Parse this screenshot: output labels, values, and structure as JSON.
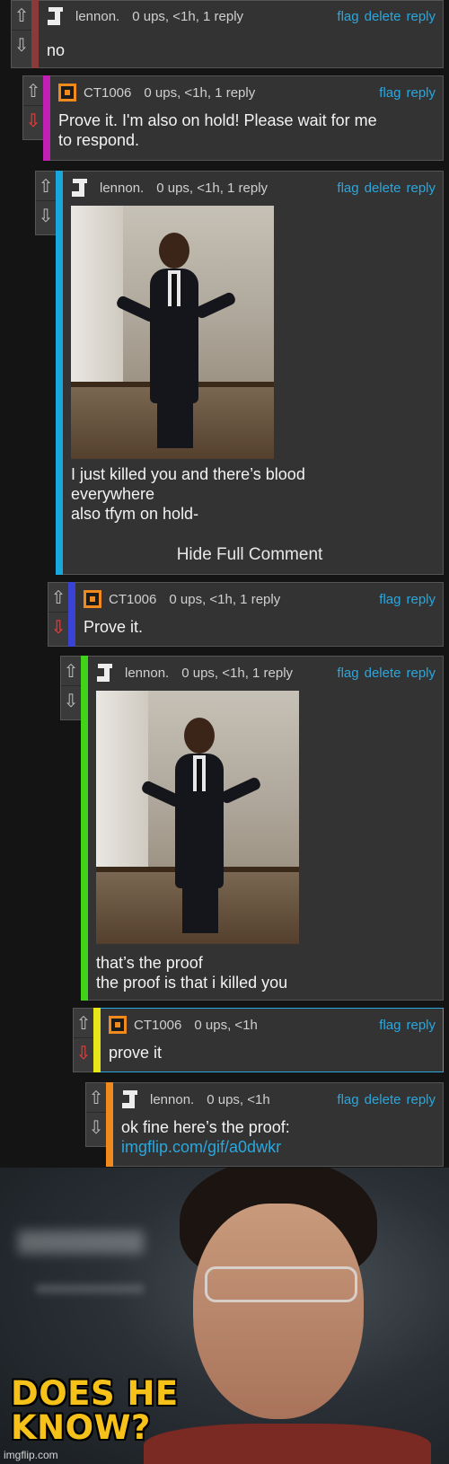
{
  "icons": {
    "upvote": "arrow-up",
    "downvote": "arrow-down"
  },
  "colors": {
    "link": "#2aa7de",
    "downvote_active": "#ff3b3b"
  },
  "comments": [
    {
      "user": "lennon.",
      "meta": "0 ups, <1h, 1 reply",
      "actions": [
        "flag",
        "delete",
        "reply"
      ],
      "text": [
        "no"
      ],
      "bar_color": "#8b3a3a"
    },
    {
      "user": "CT1006",
      "meta": "0 ups, <1h, 1 reply",
      "actions": [
        "flag",
        "reply"
      ],
      "text": [
        "Prove it. I'm also on hold! Please wait for me",
        "to respond."
      ],
      "bar_color": "#c21fb5"
    },
    {
      "user": "lennon.",
      "meta": "0 ups, <1h, 1 reply",
      "actions": [
        "flag",
        "delete",
        "reply"
      ],
      "text": [
        "I just killed you and there’s blood",
        "everywhere",
        "also tfym on hold-"
      ],
      "hide_label": "Hide Full Comment",
      "bar_color": "#19a6dc"
    },
    {
      "user": "CT1006",
      "meta": "0 ups, <1h, 1 reply",
      "actions": [
        "flag",
        "reply"
      ],
      "text": [
        "Prove it."
      ],
      "bar_color": "#3b43d6"
    },
    {
      "user": "lennon.",
      "meta": "0 ups, <1h, 1 reply",
      "actions": [
        "flag",
        "delete",
        "reply"
      ],
      "text": [
        "that’s the proof",
        "the proof is that i killed you"
      ],
      "bar_color": "#3fd41a"
    },
    {
      "user": "CT1006",
      "meta": "0 ups, <1h",
      "actions": [
        "flag",
        "reply"
      ],
      "text": [
        "prove it"
      ],
      "bar_color": "#e6e61a"
    },
    {
      "user": "lennon.",
      "meta": "0 ups, <1h",
      "actions": [
        "flag",
        "delete",
        "reply"
      ],
      "text": [
        "ok fine here’s the proof:"
      ],
      "link": "imgflip.com/gif/a0dwkr",
      "bar_color": "#f08a1c"
    }
  ],
  "meme": {
    "caption_lines": [
      "DOES HE",
      "KNOW?"
    ],
    "watermark": "imgflip.com"
  }
}
